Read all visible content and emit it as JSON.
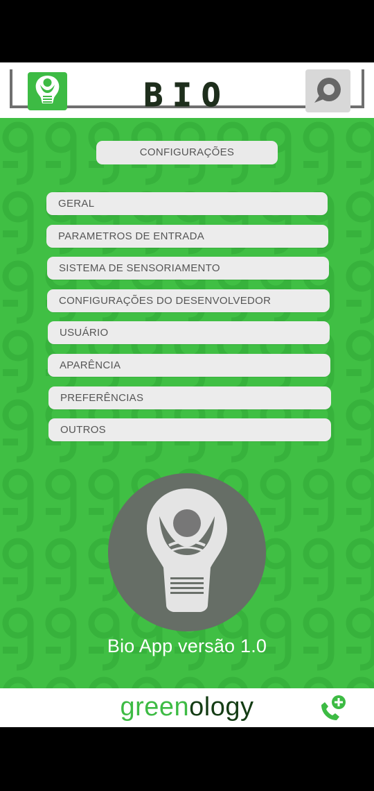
{
  "header": {
    "title": "BIO",
    "icons": {
      "left": "bulb-app-icon",
      "right": "chat-icon"
    }
  },
  "main": {
    "section_title": "CONFIGURAÇÕES",
    "menu": [
      "GERAL",
      "PARAMETROS DE ENTRADA",
      "SISTEMA DE SENSORIAMENTO",
      "CONFIGURAÇÕES DO DESENVOLVEDOR",
      "USUÁRIO",
      "APARÊNCIA",
      "PREFERÊNCIAS",
      "OUTROS"
    ],
    "version": "Bio App versão 1.0"
  },
  "footer": {
    "brand_part1": "green",
    "brand_part2": "ology",
    "icon": "phone-add-icon"
  },
  "colors": {
    "green": "#40bf44",
    "dark_text": "#1e2e1c",
    "menu_bg": "#ececec",
    "logo_circle": "#666e66"
  }
}
